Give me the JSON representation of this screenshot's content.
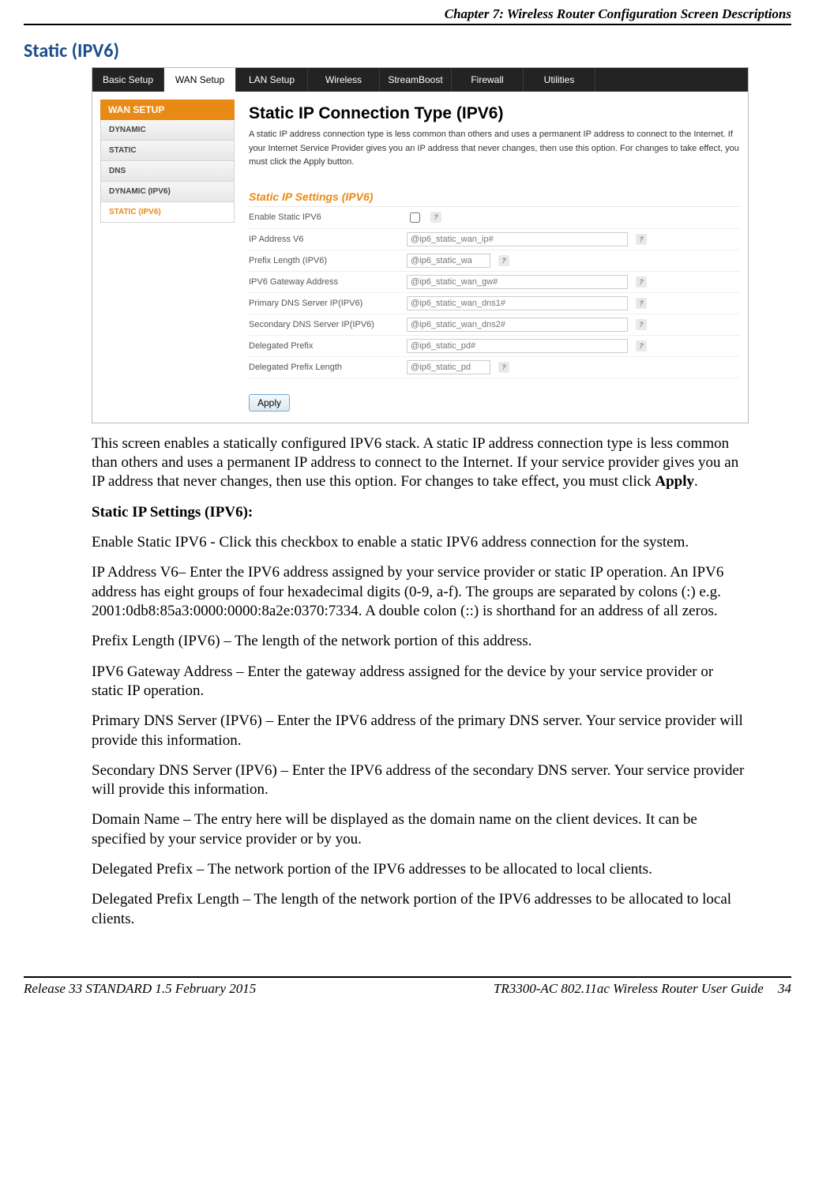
{
  "header": "Chapter 7: Wireless Router Configuration Screen Descriptions",
  "section_title": "Static (IPV6)",
  "router": {
    "tabs": [
      "Basic Setup",
      "WAN Setup",
      "LAN Setup",
      "Wireless",
      "StreamBoost",
      "Firewall",
      "Utilities"
    ],
    "active_tab_index": 1,
    "sidebar": {
      "heading": "WAN SETUP",
      "items": [
        "DYNAMIC",
        "STATIC",
        "DNS",
        "DYNAMIC (IPV6)",
        "STATIC (IPV6)"
      ],
      "active_index": 4
    },
    "panel": {
      "title": "Static IP Connection Type (IPV6)",
      "description": "A static IP address connection type is less common than others and uses a permanent IP address to connect to the Internet. If your Internet Service Provider gives you an IP address that never changes, then use this option. For changes to take effect, you must click the Apply button.",
      "subtitle": "Static IP Settings (IPV6)",
      "rows": [
        {
          "label": "Enable Static IPV6",
          "type": "checkbox"
        },
        {
          "label": "IP Address V6",
          "type": "text-wide",
          "placeholder": "@ip6_static_wan_ip#"
        },
        {
          "label": "Prefix Length (IPV6)",
          "type": "text-short",
          "placeholder": "@ip6_static_wa"
        },
        {
          "label": "IPV6 Gateway Address",
          "type": "text-wide",
          "placeholder": "@ip6_static_wan_gw#"
        },
        {
          "label": "Primary DNS Server IP(IPV6)",
          "type": "text-wide",
          "placeholder": "@ip6_static_wan_dns1#"
        },
        {
          "label": "Secondary DNS Server IP(IPV6)",
          "type": "text-wide",
          "placeholder": "@ip6_static_wan_dns2#"
        },
        {
          "label": "Delegated Prefix",
          "type": "text-wide",
          "placeholder": "@ip6_static_pd#"
        },
        {
          "label": "Delegated Prefix Length",
          "type": "text-short",
          "placeholder": "@ip6_static_pd"
        }
      ],
      "apply_label": "Apply"
    }
  },
  "paragraphs": {
    "intro_a": "This screen enables a statically configured IPV6 stack. A static IP address connection type is less common than others and uses a permanent IP address to connect to the Internet. If your service provider gives you an IP address that never changes, then use this option. For changes to take effect, you must click ",
    "intro_b": "Apply",
    "intro_c": ".",
    "heading": "Static IP Settings (IPV6):",
    "p1": "Enable Static IPV6 - Click this checkbox to enable a static IPV6 address connection for the system.",
    "p2": "IP Address V6– Enter the IPV6 address assigned by your service provider or static IP operation. An IPV6 address has eight groups of four hexadecimal digits (0-9, a-f). The groups are separated by colons (:) e.g. 2001:0db8:85a3:0000:0000:8a2e:0370:7334. A double colon (::) is shorthand for an address of all zeros.",
    "p3": "Prefix Length (IPV6) – The length of the network portion of this address.",
    "p4": "IPV6 Gateway Address – Enter the gateway address assigned for the device by your service provider or static IP operation.",
    "p5": "Primary DNS Server (IPV6) – Enter the IPV6 address of the primary DNS server. Your service provider will provide this information.",
    "p6": "Secondary DNS Server (IPV6) – Enter the IPV6 address of the secondary DNS server. Your service provider will provide this information.",
    "p7": "Domain Name – The entry here will be displayed as the domain name on the client devices. It can be specified by your service provider or by you.",
    "p8": "Delegated Prefix – The network portion of the IPV6 addresses to be allocated to local clients.",
    "p9": "Delegated Prefix Length – The length of the network portion of the IPV6 addresses to be allocated to local clients."
  },
  "footer": {
    "left": "Release 33 STANDARD 1.5    February 2015",
    "right_a": "TR3300-AC 802.11ac Wireless Router User Guide",
    "right_b": "34"
  },
  "help_glyph": "?"
}
